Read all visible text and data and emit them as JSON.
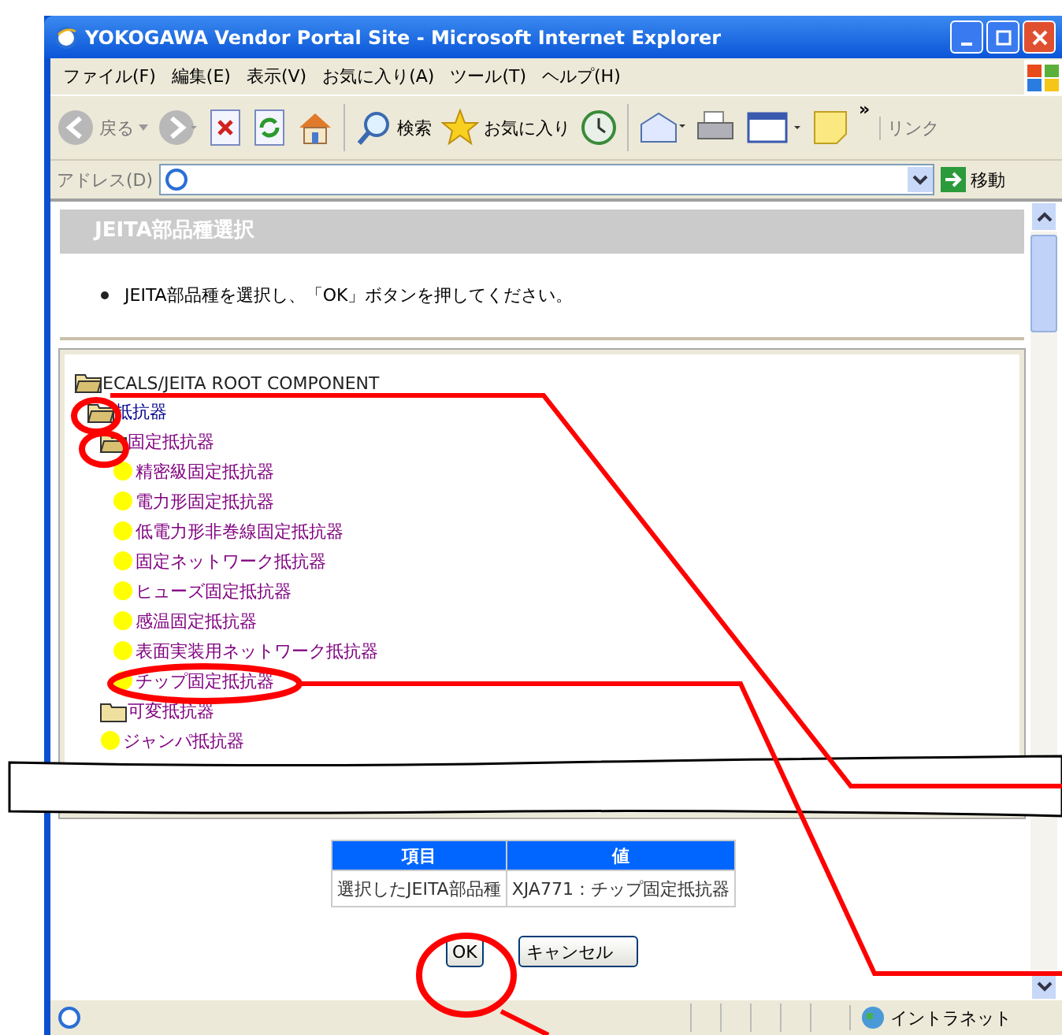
{
  "window": {
    "title": "YOKOGAWA Vendor Portal Site - Microsoft Internet Explorer"
  },
  "menu": [
    "ファイル(F)",
    "編集(E)",
    "表示(V)",
    "お気に入り(A)",
    "ツール(T)",
    "ヘルプ(H)"
  ],
  "toolbar": {
    "back": "戻る",
    "search": "検索",
    "favorites": "お気に入り",
    "more": "»",
    "links": "リンク"
  },
  "address": {
    "label": "アドレス(D)",
    "go": "移動"
  },
  "page": {
    "heading": "JEITA部品種選択",
    "instruction": "JEITA部品種を選択し、「OK」ボタンを押してください。",
    "tree": [
      {
        "label": "ECALS/JEITA ROOT COMPONENT",
        "kind": "root",
        "expanded": true,
        "children": [
          {
            "label": "抵抗器",
            "kind": "folder",
            "expanded": true,
            "visited": false,
            "children": [
              {
                "label": "固定抵抗器",
                "kind": "folder",
                "expanded": true,
                "visited": true,
                "children": [
                  {
                    "label": "精密級固定抵抗器",
                    "kind": "leaf",
                    "visited": true
                  },
                  {
                    "label": "電力形固定抵抗器",
                    "kind": "leaf",
                    "visited": true
                  },
                  {
                    "label": "低電力形非巻線固定抵抗器",
                    "kind": "leaf",
                    "visited": true
                  },
                  {
                    "label": "固定ネットワーク抵抗器",
                    "kind": "leaf",
                    "visited": true
                  },
                  {
                    "label": "ヒューズ固定抵抗器",
                    "kind": "leaf",
                    "visited": true
                  },
                  {
                    "label": "感温固定抵抗器",
                    "kind": "leaf",
                    "visited": true
                  },
                  {
                    "label": "表面実装用ネットワーク抵抗器",
                    "kind": "leaf",
                    "visited": true
                  },
                  {
                    "label": "チップ固定抵抗器",
                    "kind": "leaf",
                    "visited": true
                  }
                ]
              },
              {
                "label": "可変抵抗器",
                "kind": "folder",
                "expanded": false,
                "visited": true
              },
              {
                "label": "ジャンパ抵抗器",
                "kind": "leaf",
                "visited": true
              }
            ]
          }
        ]
      }
    ],
    "table": {
      "columns": [
        "項目",
        "値"
      ],
      "rows": [
        [
          "選択したJEITA部品種",
          "XJA771：チップ固定抵抗器"
        ]
      ]
    },
    "buttons": [
      "OK",
      "キャンセル"
    ]
  },
  "status_bar": {
    "zone": "イントラネット"
  }
}
